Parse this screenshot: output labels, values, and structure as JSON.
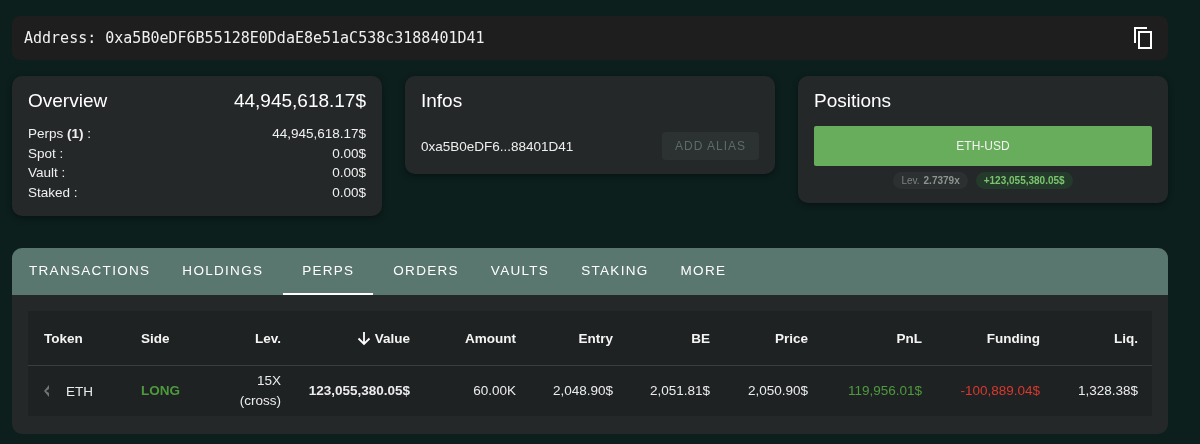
{
  "address_bar": {
    "label": "Address:",
    "value": "0xa5B0eDF6B55128E0DdaE8e51aC538c3188401D41"
  },
  "overview": {
    "title": "Overview",
    "total": "44,945,618.17$",
    "rows": [
      {
        "label": "Perps **(1)** :",
        "value": "44,945,618.17$"
      },
      {
        "label": "Spot :",
        "value": "0.00$"
      },
      {
        "label": "Vault :",
        "value": "0.00$"
      },
      {
        "label": "Staked :",
        "value": "0.00$"
      }
    ]
  },
  "infos": {
    "title": "Infos",
    "address": "0xa5B0eDF6...88401D41",
    "alias_button": {
      "label": "ADD ALIAS",
      "disabled": true
    }
  },
  "positions": {
    "title": "Positions",
    "items": [
      {
        "label": "ETH-USD",
        "lev_label": "Lev.",
        "lev_value": "2.7379x",
        "pnl": "+123,055,380.05$"
      }
    ]
  },
  "tabs": [
    {
      "label": "TRANSACTIONS",
      "selected": false
    },
    {
      "label": "HOLDINGS",
      "selected": false
    },
    {
      "label": "PERPS",
      "selected": true
    },
    {
      "label": "ORDERS",
      "selected": false
    },
    {
      "label": "VAULTS",
      "selected": false
    },
    {
      "label": "STAKING",
      "selected": false
    },
    {
      "label": "MORE",
      "selected": false
    }
  ],
  "table": {
    "columns": [
      {
        "label": "Token",
        "sorted": false
      },
      {
        "label": "Side",
        "sorted": false
      },
      {
        "label": "Lev.",
        "sorted": false
      },
      {
        "label": "Value",
        "sorted": true
      },
      {
        "label": "Amount",
        "sorted": false
      },
      {
        "label": "Entry",
        "sorted": false
      },
      {
        "label": "BE",
        "sorted": false
      },
      {
        "label": "Price",
        "sorted": false
      },
      {
        "label": "PnL",
        "sorted": false
      },
      {
        "label": "Funding",
        "sorted": false
      },
      {
        "label": "Liq.",
        "sorted": false
      }
    ],
    "rows": [
      {
        "cells": [
          {
            "text": "ETH",
            "color": "#ececec",
            "bold": false
          },
          {
            "text": "LONG",
            "color": "#4d9a3c",
            "bold": true
          },
          {
            "text": "15X (cross)",
            "color": "#ececec",
            "bold": false
          },
          {
            "text": "123,055,380.05$",
            "color": "#ececec",
            "bold": true
          },
          {
            "text": "60.00K",
            "color": "#ececec",
            "bold": false
          },
          {
            "text": "2,048.90$",
            "color": "#ececec",
            "bold": false
          },
          {
            "text": "2,051.81$",
            "color": "#ececec",
            "bold": false
          },
          {
            "text": "2,050.90$",
            "color": "#ececec",
            "bold": false
          },
          {
            "text": "119,956.01$",
            "color": "#4e9a3e",
            "bold": false
          },
          {
            "text": "-100,889.04$",
            "color": "#d9382e",
            "bold": false
          },
          {
            "text": "1,328.38$",
            "color": "#ececec",
            "bold": false
          }
        ]
      }
    ]
  }
}
